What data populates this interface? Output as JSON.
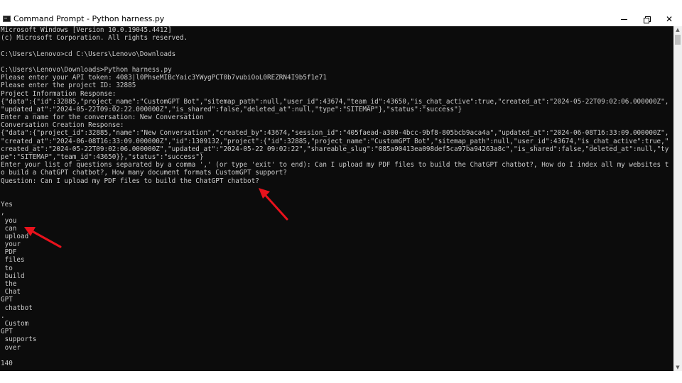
{
  "window": {
    "title": "Command Prompt - Python  harness.py",
    "minimize_glyph": "—",
    "maximize_glyph": "❐",
    "close_glyph": "✕"
  },
  "icons": {
    "app": "cmd-app-icon",
    "minimize": "minimize-icon",
    "maximize": "restore-icon",
    "close": "close-icon",
    "scroll_up": "scroll-up-arrow-icon",
    "scroll_down": "scroll-down-arrow-icon"
  },
  "colors": {
    "console_bg": "#0c0c0c",
    "console_text": "#cccccc",
    "annotation_arrow": "#e8121c"
  },
  "console": {
    "lines": [
      "Microsoft Windows [Version 10.0.19045.4412]",
      "(c) Microsoft Corporation. All rights reserved.",
      "",
      "C:\\Users\\Lenovo>cd C:\\Users\\Lenovo\\Downloads",
      "",
      "C:\\Users\\Lenovo\\Downloads>Python harness.py",
      "Please enter your API token: 4083|l0PhseMIBcYaic3YWygPCT0b7vubiOoL0REZRN4I9b5f1e71",
      "Please enter the project ID: 32885",
      "Project Information Response:",
      "{\"data\":{\"id\":32885,\"project_name\":\"CustomGPT Bot\",\"sitemap_path\":null,\"user_id\":43674,\"team_id\":43650,\"is_chat_active\":true,\"created_at\":\"2024-05-22T09:02:06.000000Z\",",
      "\"updated_at\":\"2024-05-22T09:02:22.000000Z\",\"is_shared\":false,\"deleted_at\":null,\"type\":\"SITEMAP\"},\"status\":\"success\"}",
      "Enter a name for the conversation: New Conversation",
      "Conversation Creation Response:",
      "{\"data\":{\"project_id\":32885,\"name\":\"New Conversation\",\"created_by\":43674,\"session_id\":\"405faead-a300-4bcc-9bf8-805bcb9aca4a\",\"updated_at\":\"2024-06-08T16:33:09.000000Z\",",
      "\"created_at\":\"2024-06-08T16:33:09.000000Z\",\"id\":1309132,\"project\":{\"id\":32885,\"project_name\":\"CustomGPT Bot\",\"sitemap_path\":null,\"user_id\":43674,\"is_chat_active\":true,\"",
      "created_at\":\"2024-05-22T09:02:06.000000Z\",\"updated_at\":\"2024-05-22 09:02:22\",\"shareable_slug\":\"085a90413ea098def5ca97ba94263a8c\",\"is_shared\":false,\"deleted_at\":null,\"ty",
      "pe\":\"SITEMAP\",\"team_id\":43650}},\"status\":\"success\"}",
      "Enter your list of questions separated by a comma ',' (or type 'exit' to end): Can I upload my PDF files to build the ChatGPT chatbot?, How do I index all my websites t",
      "o build a ChatGPT chatbot?, How many document formats CustomGPT support?",
      "Question: Can I upload my PDF files to build the ChatGPT chatbot?",
      "",
      "",
      "Yes",
      ",",
      " you",
      " can",
      " upload",
      " your",
      " PDF",
      " files",
      " to",
      " build",
      " the",
      " Chat",
      "GPT",
      " chatbot",
      ".",
      " Custom",
      "GPT",
      " supports",
      " over",
      "",
      "140"
    ]
  }
}
